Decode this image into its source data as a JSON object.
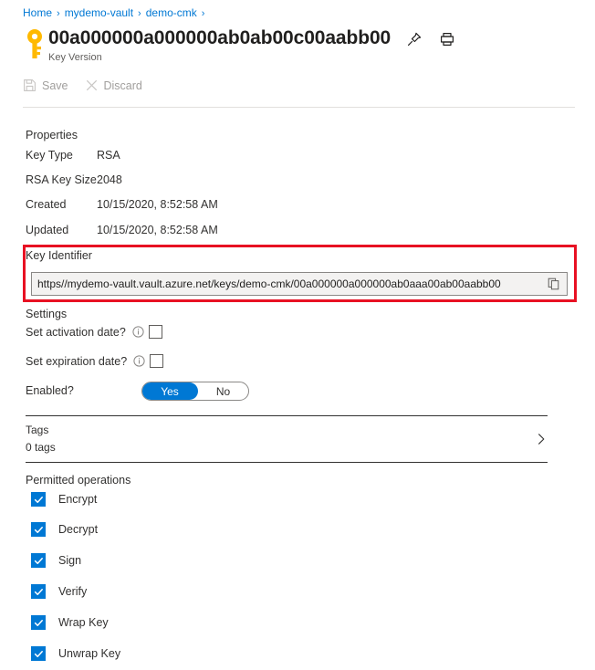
{
  "breadcrumb": {
    "items": [
      {
        "label": "Home"
      },
      {
        "label": "mydemo-vault"
      },
      {
        "label": "demo-cmk"
      }
    ],
    "separator": "›"
  },
  "header": {
    "title": "00a000000a000000ab0ab00c00aabb00",
    "subtitle": "Key Version",
    "key_icon": "key-icon",
    "pin_icon": "pin-icon",
    "print_icon": "print-icon"
  },
  "commandbar": {
    "save_label": "Save",
    "save_icon": "save-disk-icon",
    "discard_label": "Discard",
    "discard_icon": "close-x-icon"
  },
  "properties": {
    "heading": "Properties",
    "rows": [
      {
        "label": "Key Type",
        "value": "RSA"
      },
      {
        "label": "RSA Key Size",
        "value": "2048"
      },
      {
        "label": "Created",
        "value": "10/15/2020, 8:52:58 AM"
      },
      {
        "label": "Updated",
        "value": "10/15/2020, 8:52:58 AM"
      }
    ]
  },
  "key_identifier": {
    "label": "Key Identifier",
    "value": "https//mydemo-vault.vault.azure.net/keys/demo-cmk/00a000000a000000ab0aaa00ab00aabb00",
    "copy_icon": "copy-icon",
    "highlight_color": "#e81123"
  },
  "settings": {
    "heading": "Settings",
    "activation": {
      "label": "Set activation date?",
      "info_icon": "info-icon",
      "checked": false
    },
    "expiration": {
      "label": "Set expiration date?",
      "info_icon": "info-icon",
      "checked": false
    },
    "enabled": {
      "label": "Enabled?",
      "on_label": "Yes",
      "off_label": "No",
      "value": "Yes",
      "accent_color": "#0078d4"
    }
  },
  "tags": {
    "title": "Tags",
    "count_label": "0 tags",
    "chevron_icon": "chevron-right-icon"
  },
  "permitted_operations": {
    "heading": "Permitted operations",
    "items": [
      {
        "label": "Encrypt",
        "checked": true
      },
      {
        "label": "Decrypt",
        "checked": true
      },
      {
        "label": "Sign",
        "checked": true
      },
      {
        "label": "Verify",
        "checked": true
      },
      {
        "label": "Wrap Key",
        "checked": true
      },
      {
        "label": "Unwrap Key",
        "checked": true
      }
    ]
  }
}
